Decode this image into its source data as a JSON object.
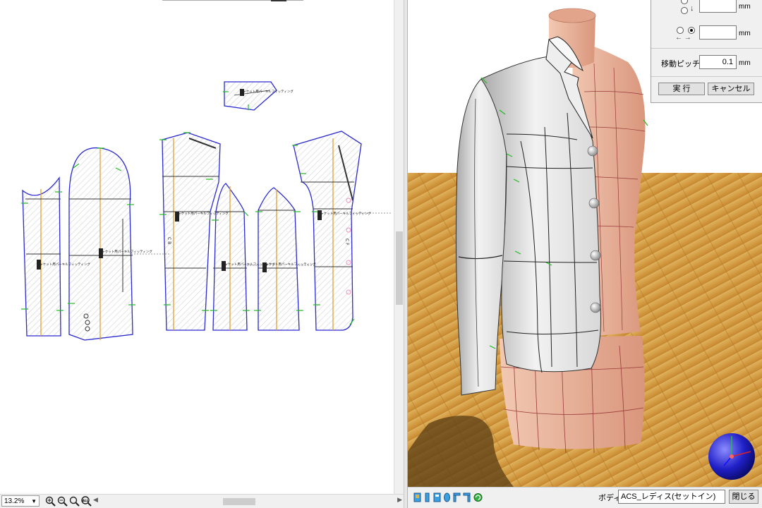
{
  "pattern_pane": {
    "piece_label": "ジャケット用パーキルフィッティング",
    "markers": {
      "cb": "C B",
      "cf": "C F"
    },
    "zoom_level": "13.2%",
    "zoom_buttons": [
      "zoom-in",
      "zoom-out",
      "zoom-fit",
      "zoom-all"
    ],
    "zoom_all_label": "ALL"
  },
  "dialog": {
    "pitch_label": "移動ピッチ",
    "pitch_value": "0.1",
    "unit": "mm",
    "field_1_value": "",
    "field_2_value": "",
    "down_arrow": "↓",
    "horizontal_arrows": "← →",
    "execute_label": "実 行",
    "cancel_label": "キャンセル"
  },
  "view3d": {
    "body_label": "ボディ",
    "body_value": "ACS_レディス(セットイン)",
    "close_label": "閉じる",
    "toolbar_icons": [
      "front-view-icon",
      "side-view-icon",
      "back-view-icon",
      "rotate-view-icon",
      "left-view-icon",
      "right-view-icon",
      "refresh-icon"
    ]
  },
  "colors": {
    "outline": "#2a2ad0",
    "grainline": "#e0a030",
    "mark": "#22bb22",
    "floor": "#d79a3e",
    "skin": "#e9b49c"
  }
}
